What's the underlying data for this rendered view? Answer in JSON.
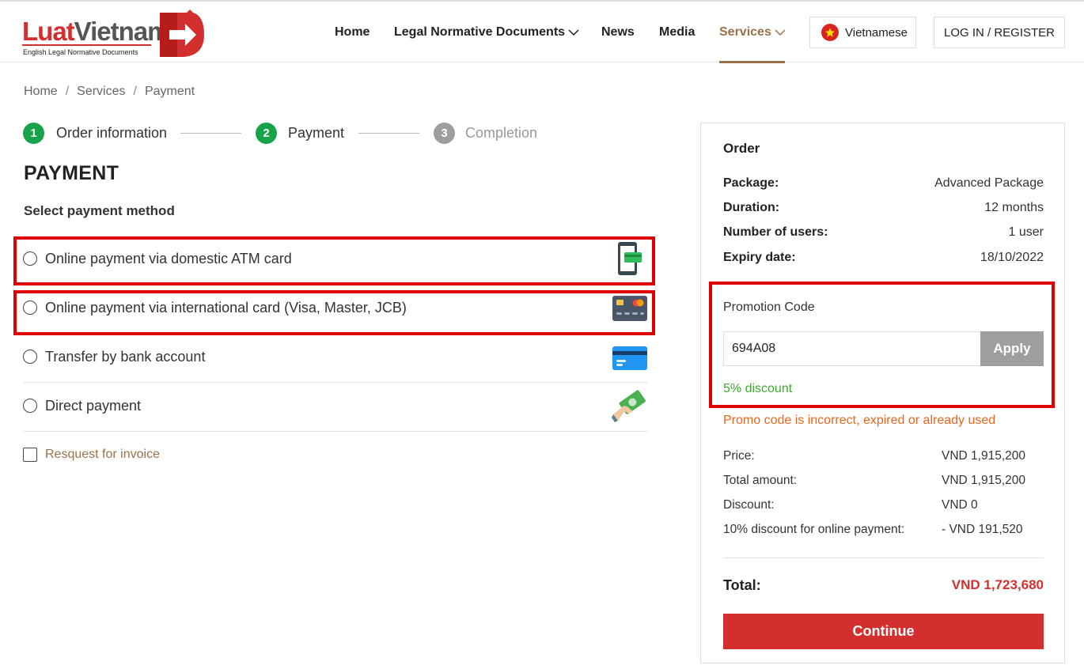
{
  "header": {
    "logo": {
      "brand_part1": "Luat",
      "brand_part2": "Vietnam",
      "tagline": "English Legal Normative Documents"
    },
    "nav": [
      {
        "label": "Home"
      },
      {
        "label": "Legal Normative Documents",
        "has_dropdown": true
      },
      {
        "label": "News"
      },
      {
        "label": "Media"
      },
      {
        "label": "Services",
        "has_dropdown": true,
        "active": true
      }
    ],
    "language": "Vietnamese",
    "login": "LOG IN / REGISTER"
  },
  "breadcrumb": [
    "Home",
    "Services",
    "Payment"
  ],
  "steps": [
    {
      "number": "1",
      "label": "Order information",
      "state": "done"
    },
    {
      "number": "2",
      "label": "Payment",
      "state": "current"
    },
    {
      "number": "3",
      "label": "Completion",
      "state": "todo"
    }
  ],
  "page_title": "PAYMENT",
  "select_method_label": "Select payment method",
  "payment_methods": [
    {
      "label": "Online payment via domestic ATM card",
      "icon": "mobile-card-icon",
      "highlighted": true
    },
    {
      "label": "Online payment via international card (Visa, Master, JCB)",
      "icon": "credit-card-icon",
      "highlighted": true
    },
    {
      "label": "Transfer by bank account",
      "icon": "bank-card-icon",
      "highlighted": false
    },
    {
      "label": "Direct payment",
      "icon": "cash-hand-icon",
      "highlighted": false
    }
  ],
  "invoice_label": "Resquest for invoice",
  "order": {
    "title": "Order",
    "details": [
      {
        "key": "Package:",
        "value": "Advanced Package"
      },
      {
        "key": "Duration:",
        "value": "12 months"
      },
      {
        "key": "Number of users:",
        "value": "1 user"
      },
      {
        "key": "Expiry date:",
        "value": "18/10/2022"
      }
    ],
    "promo": {
      "label": "Promotion Code",
      "value": "694A08",
      "apply_label": "Apply",
      "discount_text": "5% discount",
      "error_text": "Promo code is incorrect, expired or already used"
    },
    "prices": [
      {
        "key": "Price:",
        "value": "VND 1,915,200"
      },
      {
        "key": "Total amount:",
        "value": "VND 1,915,200"
      },
      {
        "key": "Discount:",
        "value": "VND 0"
      },
      {
        "key": "10% discount for online payment:",
        "value": "- VND 191,520"
      }
    ],
    "total_label": "Total:",
    "total_value": "VND 1,723,680",
    "continue_label": "Continue"
  },
  "colors": {
    "brand_red": "#d32f2f",
    "accent_brown": "#9a7048",
    "step_green": "#17a34a",
    "highlight_red": "#e00000",
    "discount_green": "#3fab2e",
    "error_orange": "#e8651a"
  }
}
